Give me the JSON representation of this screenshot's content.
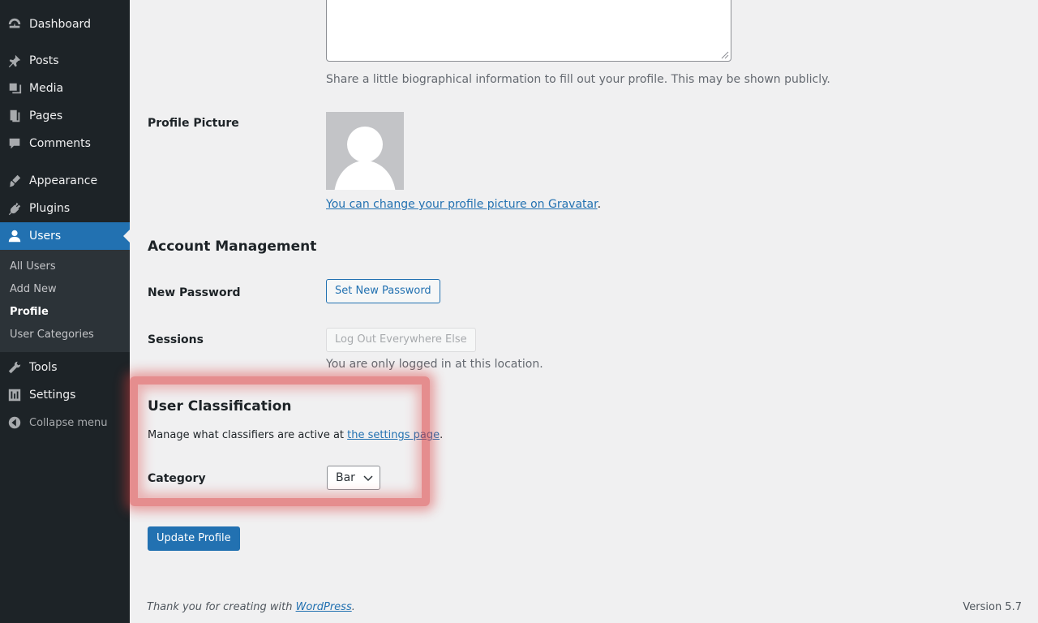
{
  "sidebar": {
    "items": [
      {
        "label": "Dashboard",
        "icon": "dashboard-icon"
      },
      {
        "label": "Posts",
        "icon": "pin-icon"
      },
      {
        "label": "Media",
        "icon": "media-icon"
      },
      {
        "label": "Pages",
        "icon": "pages-icon"
      },
      {
        "label": "Comments",
        "icon": "comment-icon"
      },
      {
        "label": "Appearance",
        "icon": "brush-icon"
      },
      {
        "label": "Plugins",
        "icon": "plug-icon"
      },
      {
        "label": "Users",
        "icon": "user-icon",
        "active": true
      },
      {
        "label": "Tools",
        "icon": "wrench-icon"
      },
      {
        "label": "Settings",
        "icon": "settings-icon"
      }
    ],
    "submenu": [
      "All Users",
      "Add New",
      "Profile",
      "User Categories"
    ],
    "collapse_label": "Collapse menu"
  },
  "bio": {
    "description": "Share a little biographical information to fill out your profile. This may be shown publicly."
  },
  "profile_picture": {
    "label": "Profile Picture",
    "link_text": "You can change your profile picture on Gravatar",
    "link_suffix": "."
  },
  "account": {
    "title": "Account Management",
    "new_password_label": "New Password",
    "set_password_button": "Set New Password",
    "sessions_label": "Sessions",
    "logout_button": "Log Out Everywhere Else",
    "sessions_note": "You are only logged in at this location."
  },
  "classification": {
    "title": "User Classification",
    "desc_prefix": "Manage what classifiers are active at ",
    "desc_link": "the settings page",
    "desc_suffix": ".",
    "category_label": "Category",
    "category_value": "Bar"
  },
  "update_button": "Update Profile",
  "footer": {
    "thanks_prefix": "Thank you for creating with ",
    "thanks_link": "WordPress",
    "thanks_suffix": ".",
    "version": "Version 5.7"
  },
  "colors": {
    "sidebar_bg": "#1d2327",
    "accent": "#2271b1",
    "page_bg": "#f0f0f1",
    "highlight": "#dc3c3c"
  }
}
